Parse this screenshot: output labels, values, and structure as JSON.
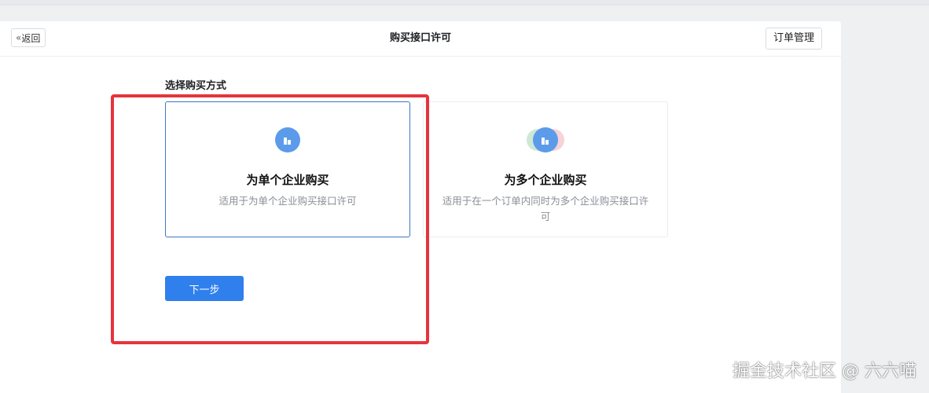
{
  "header": {
    "back_label": "返回",
    "title": "购买接口许可",
    "orders_label": "订单管理"
  },
  "purchase": {
    "section_label": "选择购买方式",
    "options": [
      {
        "title": "为单个企业购买",
        "description": "适用于为单个企业购买接口许可",
        "selected": true,
        "icon": "building-icon"
      },
      {
        "title": "为多个企业购买",
        "description": "适用于在一个订单内同时为多个企业购买接口许可",
        "selected": false,
        "icon": "multi-building-icon"
      }
    ],
    "next_label": "下一步"
  },
  "watermark": "掘金技术社区 @ 六六喵",
  "colors": {
    "primary": "#2f80ed",
    "selected_border": "#3a78c3",
    "icon_blue": "#5b9bea",
    "highlight_red": "#e5343d"
  }
}
